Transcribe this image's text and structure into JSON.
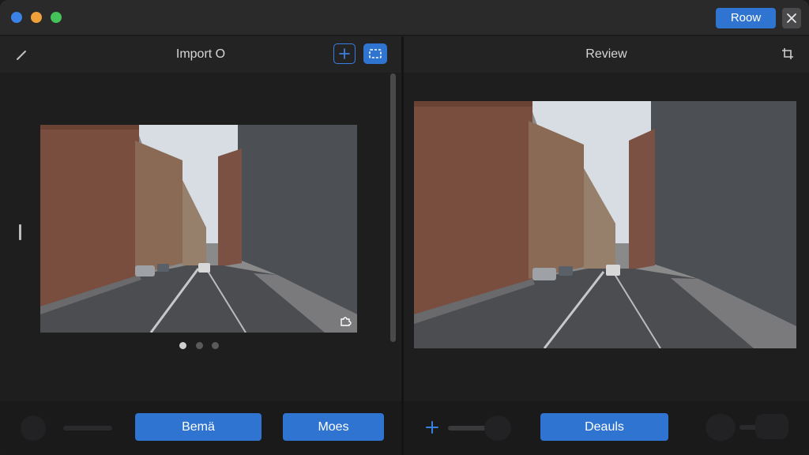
{
  "titlebar": {
    "primary_button_label": "Roow",
    "close_icon": "close-icon"
  },
  "left_panel": {
    "title": "Import O",
    "edit_icon": "pencil-icon",
    "add_icon": "plus-icon",
    "frame_icon": "frame-icon",
    "corner_icon": "puzzle-icon",
    "carousel": {
      "count": 3,
      "active_index": 0
    },
    "toolbar": {
      "button_1_label": "Bemä",
      "button_2_label": "Moes"
    }
  },
  "right_panel": {
    "title": "Review",
    "header_icon": "crop-icon",
    "toolbar": {
      "add_icon": "plus-icon",
      "button_label": "Deauls"
    }
  },
  "colors": {
    "accent": "#2f74d0",
    "window_bg": "#202021",
    "panel_bg": "#1e1e1f",
    "traffic_blue": "#3b82e6",
    "traffic_orange": "#f0a03a",
    "traffic_green": "#43c35a"
  }
}
